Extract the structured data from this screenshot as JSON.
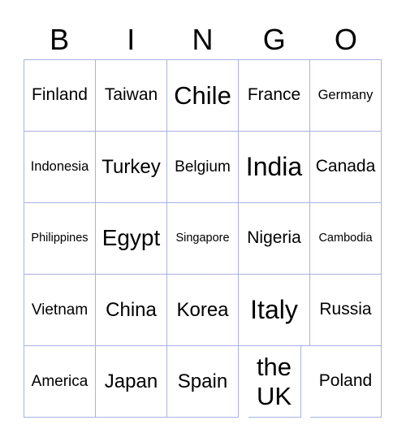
{
  "header": [
    "B",
    "I",
    "N",
    "G",
    "O"
  ],
  "cells": [
    {
      "text": "Finland",
      "size": "s20"
    },
    {
      "text": "Taiwan",
      "size": "s20"
    },
    {
      "text": "Chile",
      "size": "s30"
    },
    {
      "text": "France",
      "size": "s20"
    },
    {
      "text": "Germany",
      "size": "s16"
    },
    {
      "text": "Indonesia",
      "size": "s16"
    },
    {
      "text": "Turkey",
      "size": "s24"
    },
    {
      "text": "Belgium",
      "size": "s18"
    },
    {
      "text": "India",
      "size": "s32"
    },
    {
      "text": "Canada",
      "size": "s20"
    },
    {
      "text": "Philippines",
      "size": "s14"
    },
    {
      "text": "Egypt",
      "size": "s28"
    },
    {
      "text": "Singapore",
      "size": "s14"
    },
    {
      "text": "Nigeria",
      "size": "s20"
    },
    {
      "text": "Cambodia",
      "size": "s14"
    },
    {
      "text": "Vietnam",
      "size": "s18"
    },
    {
      "text": "China",
      "size": "s24"
    },
    {
      "text": "Korea",
      "size": "s24"
    },
    {
      "text": "Italy",
      "size": "s32"
    },
    {
      "text": "Russia",
      "size": "s20"
    },
    {
      "text": "America",
      "size": "s18"
    },
    {
      "text": "Japan",
      "size": "s24"
    },
    {
      "text": "Spain",
      "size": "s24"
    },
    {
      "text": "the UK",
      "size": "s30"
    },
    {
      "text": "Poland",
      "size": "s20"
    }
  ]
}
